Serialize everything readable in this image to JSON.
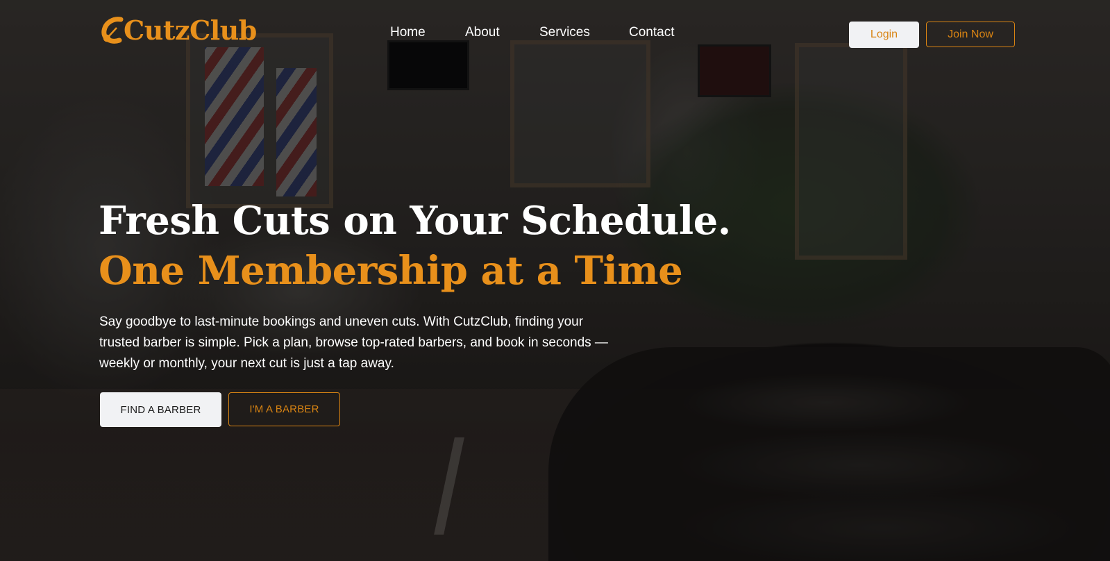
{
  "brand": {
    "name": "CutzClub",
    "logo_icon": "scissors-icon",
    "accent_color": "#e8901b"
  },
  "nav": {
    "items": [
      {
        "label": "Home"
      },
      {
        "label": "About"
      },
      {
        "label": "Services"
      },
      {
        "label": "Contact"
      }
    ],
    "login_label": "Login",
    "join_label": "Join Now"
  },
  "hero": {
    "headline_line1": "Fresh Cuts on Your Schedule.",
    "headline_line2": "One Membership at a Time",
    "description": "Say goodbye to last-minute bookings and uneven cuts. With CutzClub, finding your trusted barber is simple. Pick a plan, browse top-rated barbers, and book in seconds — weekly or monthly, your next cut is just a tap away.",
    "primary_cta": "FIND A BARBER",
    "secondary_cta": "I'M A BARBER"
  }
}
